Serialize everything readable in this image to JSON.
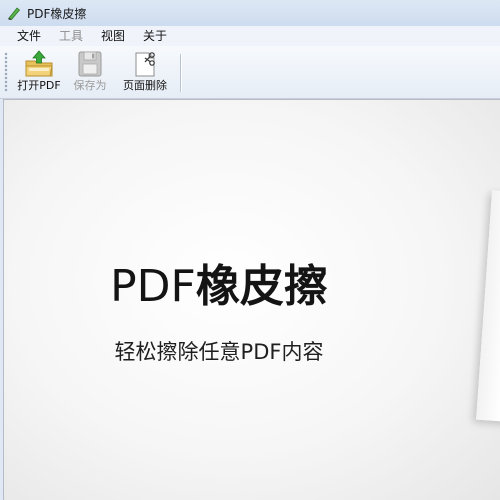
{
  "window": {
    "title": "PDF橡皮擦"
  },
  "menubar": {
    "items": [
      {
        "label": "文件",
        "enabled": true
      },
      {
        "label": "工具",
        "enabled": false
      },
      {
        "label": "视图",
        "enabled": true
      },
      {
        "label": "关于",
        "enabled": true
      }
    ]
  },
  "toolbar": {
    "open_label": "打开PDF",
    "save_label": "保存为",
    "delete_label": "页面删除",
    "save_enabled": false
  },
  "main": {
    "title_latin": "PDF",
    "title_cn": "橡皮擦",
    "subtitle": "轻松擦除任意PDF内容"
  },
  "colors": {
    "titlebar": "#cddcef",
    "toolbar": "#e6edf6",
    "content": "#f6f6f6",
    "open_icon_green": "#3aa83a",
    "folder_yellow": "#e8c15a"
  },
  "icons": {
    "app": "eraser-pencil-icon",
    "open": "open-folder-icon",
    "save": "floppy-disk-icon",
    "delete": "page-delete-icon"
  }
}
